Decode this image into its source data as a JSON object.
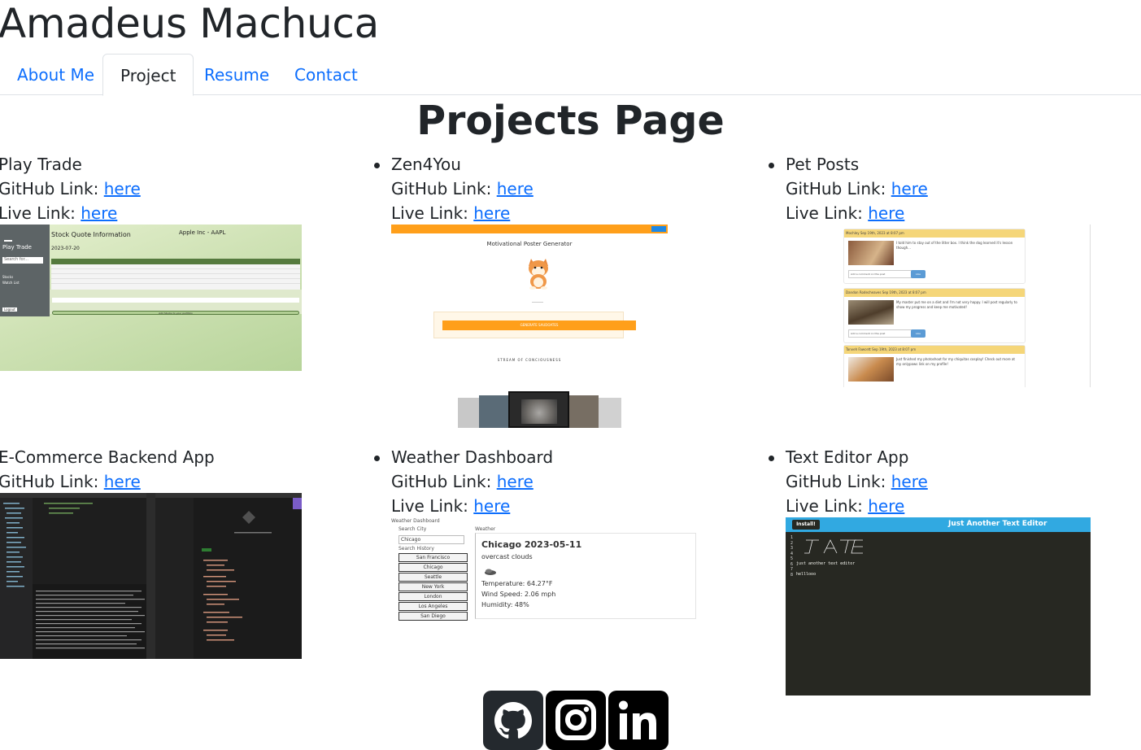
{
  "site": {
    "name": "Amadeus Machuca"
  },
  "nav": {
    "tabs": [
      {
        "label": "About Me"
      },
      {
        "label": "Project"
      },
      {
        "label": "Resume"
      },
      {
        "label": "Contact"
      }
    ],
    "active_tab": "Project"
  },
  "page": {
    "heading": "Projects Page"
  },
  "link_text": "here",
  "github_prefix": "GitHub Link: ",
  "live_prefix": "Live Link: ",
  "projects": [
    {
      "title": "Play Trade",
      "screenshot": {
        "app_title": "Play Trade",
        "search_placeholder": "Search for...",
        "heading": "Stock Quote Information",
        "company": "Apple Inc - AAPL",
        "date": "2023-07-20",
        "button": "Add Stocks to your portfolio"
      }
    },
    {
      "title": "Zen4You",
      "screenshot": {
        "heading": "Motivational Poster Generator",
        "button": "GENERATE SAUDOATES",
        "stream": "STREAM OF CONCIOUSNESS"
      }
    },
    {
      "title": "Pet Posts",
      "screenshot": {
        "posts": [
          {
            "header": "Mochley Sep 19th, 2023 at 8:07 pm",
            "text": "I told him to stay out of the litter box. I think the dog learned it's lesson though...",
            "comment": "Add a comment on this post",
            "like": "Like"
          },
          {
            "header": "Dandon Rodecheaves Sep 19th, 2023 at 8:07 pm",
            "text": "My master put me on a diet and I'm not very happy. I will post regularly to show my progress and keep me motivated!",
            "comment": "Add a comment on this post",
            "like": "Like"
          },
          {
            "header": "Tanveh Fawcett Sep 19th, 2023 at 8:07 pm",
            "text": "Just finished my photoshoot for my chiquitas cosplay! Check out more at my onlypaws link on my profile!",
            "comment": "",
            "like": ""
          }
        ]
      }
    },
    {
      "title": "E-Commerce Backend App"
    },
    {
      "title": "Weather Dashboard",
      "screenshot": {
        "app_title": "Weather Dashboard",
        "search_label": "Search City",
        "search_value": "Chicago",
        "history_label": "Search History",
        "history": [
          "San Francisco",
          "Chicago",
          "Seattle",
          "New York",
          "London",
          "Los Angeles",
          "San Diego"
        ],
        "weather_label": "Weather",
        "city_date": "Chicago 2023-05-11",
        "condition": "overcast clouds",
        "temperature": "Temperature: 64.27°F",
        "wind": "Wind Speed: 2.06 mph",
        "humidity": "Humidity: 48%"
      }
    },
    {
      "title": "Text Editor App",
      "screenshot": {
        "install_button": "Install!",
        "header_title": "Just Another Text Editor",
        "line_numbers": "1\n2\n3\n4\n5\n6\n7\n8",
        "subtitle": "just another text editor",
        "code_line": "helllooo"
      }
    }
  ],
  "social": [
    {
      "name": "github",
      "color": "#24292e"
    },
    {
      "name": "instagram",
      "color": "#000000"
    },
    {
      "name": "linkedin",
      "color": "#000000"
    }
  ]
}
